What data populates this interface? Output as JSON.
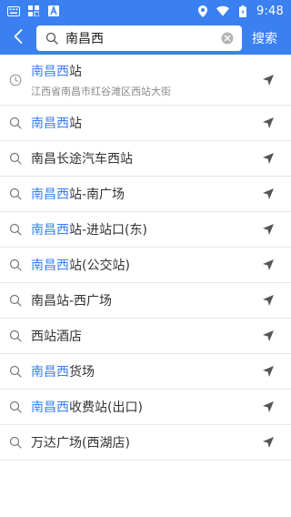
{
  "status_bar": {
    "time": "9:48",
    "left_icons": [
      "keyboard-icon",
      "screen-icon",
      "a-box-icon"
    ],
    "right_icons": [
      "location-icon",
      "wifi-icon",
      "battery-icon"
    ]
  },
  "search": {
    "query": "南昌西",
    "button_label": "搜索"
  },
  "colors": {
    "accent": "#3a80f1",
    "text": "#333333",
    "subtext": "#888888",
    "icon": "#666666"
  },
  "results": [
    {
      "type": "history",
      "highlight": "南昌西",
      "rest": "站",
      "sub": "江西省南昌市红谷滩区西站大街"
    },
    {
      "type": "search",
      "highlight": "南昌西",
      "rest": "站"
    },
    {
      "type": "search",
      "highlight": "",
      "rest": "南昌长途汽车西站"
    },
    {
      "type": "search",
      "highlight": "南昌西",
      "rest": "站-南广场"
    },
    {
      "type": "search",
      "highlight": "南昌西",
      "rest": "站-进站口(东)"
    },
    {
      "type": "search",
      "highlight": "南昌西",
      "rest": "站(公交站)"
    },
    {
      "type": "search",
      "highlight": "",
      "rest": "南昌站-西广场"
    },
    {
      "type": "search",
      "highlight": "",
      "rest": "西站酒店"
    },
    {
      "type": "search",
      "highlight": "南昌西",
      "rest": "货场"
    },
    {
      "type": "search",
      "highlight": "南昌西",
      "rest": "收费站(出口)"
    },
    {
      "type": "search",
      "highlight": "",
      "rest": "万达广场(西湖店)"
    }
  ]
}
